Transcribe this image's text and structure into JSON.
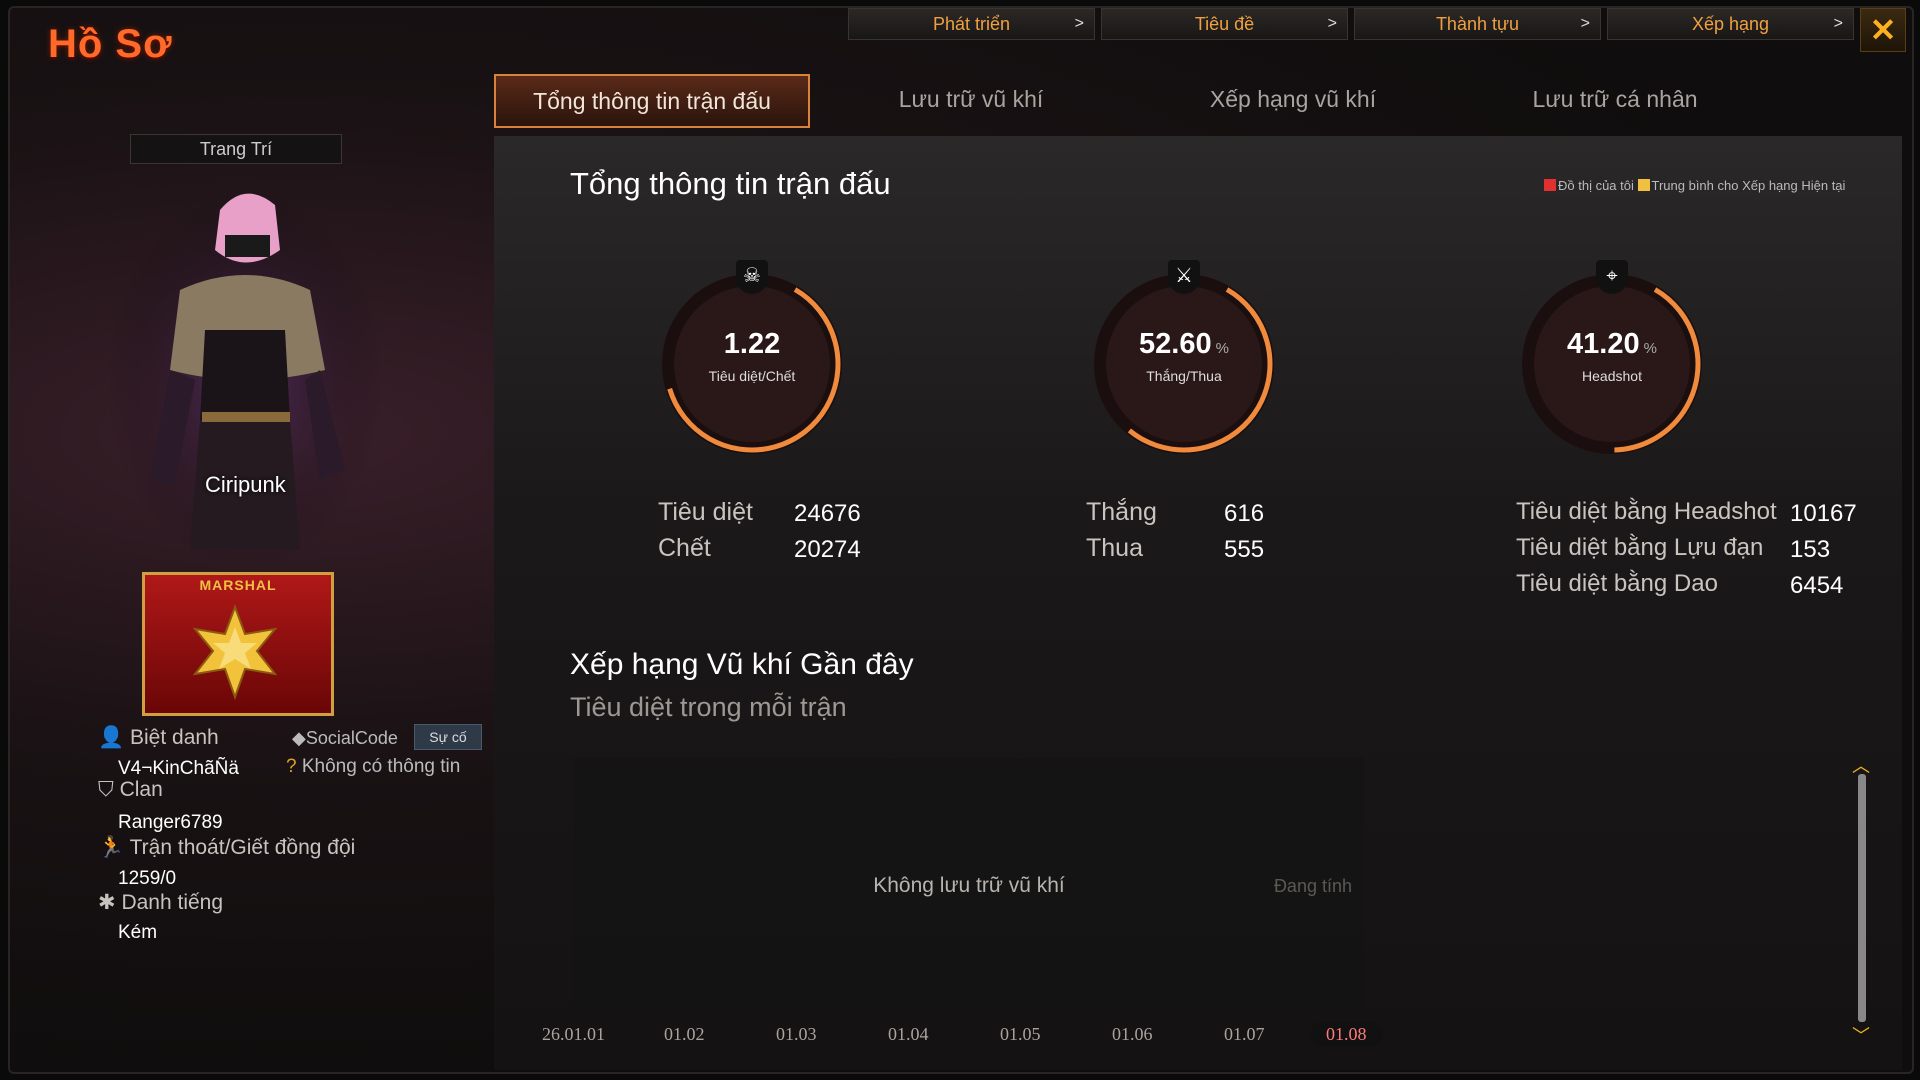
{
  "window": {
    "title": "Hồ Sơ"
  },
  "top_nav": [
    {
      "label": "Phát triển",
      "arrow": ">"
    },
    {
      "label": "Tiêu đề",
      "arrow": ">"
    },
    {
      "label": "Thành tựu",
      "arrow": ">"
    },
    {
      "label": "Xếp hạng",
      "arrow": ">"
    }
  ],
  "close_label": "✕",
  "tabs": [
    {
      "label": "Tổng thông tin trận đấu",
      "active": true
    },
    {
      "label": "Lưu trữ vũ khí",
      "active": false
    },
    {
      "label": "Xếp hạng vũ khí",
      "active": false
    },
    {
      "label": "Lưu trữ cá nhân",
      "active": false
    }
  ],
  "profile": {
    "decor_button": "Trang Trí",
    "character_name": "Ciripunk",
    "rank_badge": "MARSHAL",
    "nickname_label": "Biệt danh",
    "nickname": "V4¬KinChãÑä",
    "socialcode_label": "SocialCode",
    "incident_button": "Sự cố",
    "socialcode_value": "Không có thông tin",
    "clan_label": "Clan",
    "clan": "Ranger6789",
    "escape_label": "Trận thoát/Giết đồng đội",
    "escape_value": "1259/0",
    "reputation_label": "Danh tiếng",
    "reputation": "Kém"
  },
  "overview": {
    "title": "Tổng thông tin trận đấu",
    "legend_mine": "Đồ thị của tôi",
    "legend_avg": "Trung bình cho Xếp hạng Hiện tại",
    "gauges": [
      {
        "value": "1.22",
        "unit": "",
        "label": "Tiêu diệt/Chết",
        "icon": "skull-icon",
        "fill": 0.62
      },
      {
        "value": "52.60",
        "unit": "%",
        "label": "Thắng/Thua",
        "icon": "crossed-swords-icon",
        "fill": 0.526
      },
      {
        "value": "41.20",
        "unit": "%",
        "label": "Headshot",
        "icon": "crosshair-icon",
        "fill": 0.412
      }
    ],
    "stats": {
      "kills_label": "Tiêu diệt",
      "kills": "24676",
      "deaths_label": "Chết",
      "deaths": "20274",
      "wins_label": "Thắng",
      "wins": "616",
      "losses_label": "Thua",
      "losses": "555",
      "hs_kills_label": "Tiêu diệt bằng Headshot",
      "hs_kills": "10167",
      "grenade_kills_label": "Tiêu diệt bằng Lựu đạn",
      "grenade_kills": "153",
      "knife_kills_label": "Tiêu diệt bằng Dao",
      "knife_kills": "6454"
    }
  },
  "weapon_rank": {
    "title": "Xếp hạng Vũ khí Gần đây",
    "subtitle": "Tiêu diệt trong mỗi trận",
    "empty_text": "Không lưu trữ vũ khí",
    "calculating": "Đang tính",
    "x_ticks": [
      "26.01.01",
      "01.02",
      "01.03",
      "01.04",
      "01.05",
      "01.06",
      "01.07",
      "01.08"
    ],
    "selected_tick": "01.08"
  },
  "colors": {
    "accent": "#ff6a2a",
    "gauge_arc": "#f08a3c",
    "selected_tick": "#ff7a7a",
    "legend_mine": "#e03030",
    "legend_avg": "#f0c040"
  }
}
